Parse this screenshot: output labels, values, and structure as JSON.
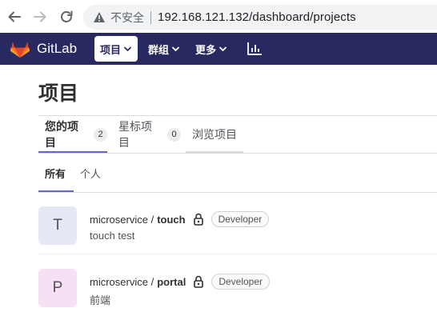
{
  "browser": {
    "security_warning": "不安全",
    "url": "192.168.121.132/dashboard/projects"
  },
  "header": {
    "brand": "GitLab",
    "menu": [
      {
        "label": "项目"
      },
      {
        "label": "群组"
      },
      {
        "label": "更多"
      }
    ],
    "colors": {
      "navbar": "#292961",
      "accent": "#6666c4"
    }
  },
  "page": {
    "title": "项目",
    "tabs": [
      {
        "label": "您的项目",
        "count": "2"
      },
      {
        "label": "星标项目",
        "count": "0"
      },
      {
        "label": "浏览项目"
      }
    ],
    "subtabs": [
      {
        "label": "所有"
      },
      {
        "label": "个人"
      }
    ],
    "projects": [
      {
        "avatar": "T",
        "namespace": "microservice /",
        "name": "touch",
        "role": "Developer",
        "description": "touch test"
      },
      {
        "avatar": "P",
        "namespace": "microservice /",
        "name": "portal",
        "role": "Developer",
        "description": "前端"
      }
    ]
  }
}
